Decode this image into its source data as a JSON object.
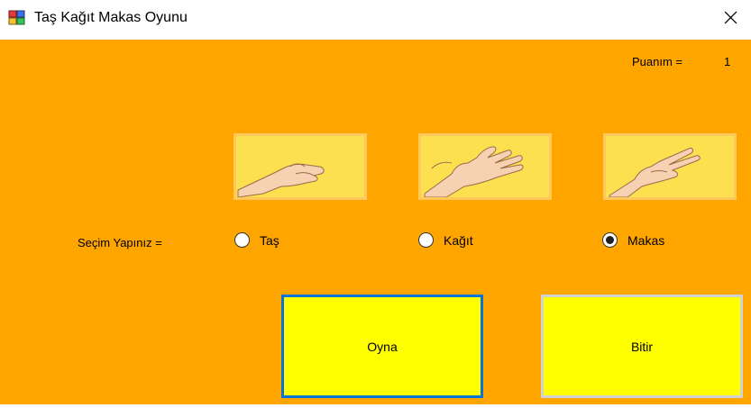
{
  "window": {
    "title": "Taş Kağıt Makas Oyunu",
    "icons": {
      "app": "windows-form-icon",
      "close": "close-icon"
    }
  },
  "score": {
    "label": "Puanım =",
    "value": "1"
  },
  "choices_images": [
    "rock-hand-image",
    "paper-hand-image",
    "scissors-hand-image"
  ],
  "prompt": "Seçim Yapınız =",
  "options": [
    {
      "label": "Taş",
      "selected": false
    },
    {
      "label": "Kağıt",
      "selected": false
    },
    {
      "label": "Makas",
      "selected": true
    }
  ],
  "buttons": {
    "play": "Oyna",
    "finish": "Bitir"
  },
  "colors": {
    "background": "#ffa500",
    "button": "#ffff00",
    "focus_border": "#0a74d6"
  }
}
